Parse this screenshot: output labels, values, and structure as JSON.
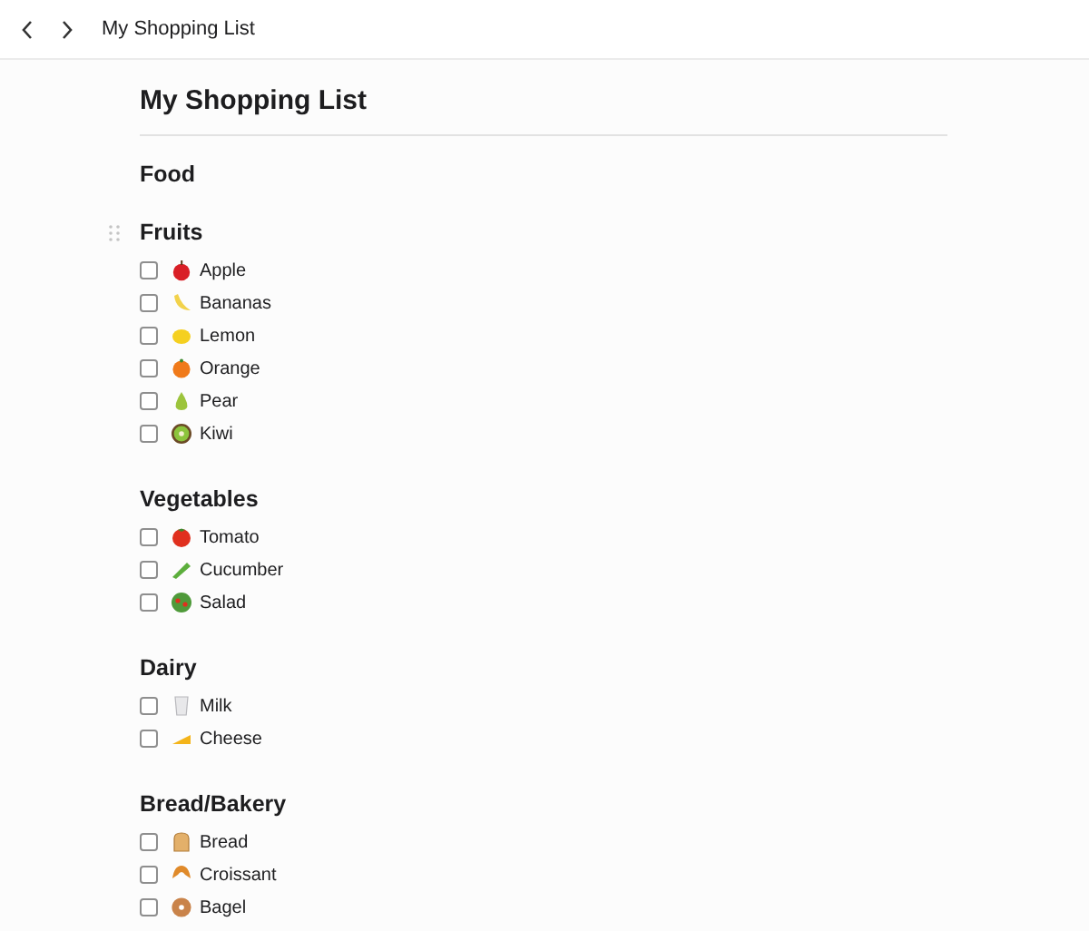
{
  "window": {
    "title": "My Shopping List"
  },
  "page": {
    "title": "My Shopping List",
    "subtitle": "Food"
  },
  "sections": [
    {
      "heading": "Fruits",
      "drag_handle": true,
      "items": [
        {
          "label": "Apple",
          "kind": "apple",
          "checked": false
        },
        {
          "label": "Bananas",
          "kind": "banana",
          "checked": false
        },
        {
          "label": "Lemon",
          "kind": "lemon",
          "checked": false
        },
        {
          "label": "Orange",
          "kind": "orange",
          "checked": false
        },
        {
          "label": "Pear",
          "kind": "pear",
          "checked": false
        },
        {
          "label": "Kiwi",
          "kind": "kiwi",
          "checked": false
        }
      ]
    },
    {
      "heading": "Vegetables",
      "drag_handle": false,
      "items": [
        {
          "label": "Tomato",
          "kind": "tomato",
          "checked": false
        },
        {
          "label": "Cucumber",
          "kind": "cucumber",
          "checked": false
        },
        {
          "label": "Salad",
          "kind": "salad",
          "checked": false
        }
      ]
    },
    {
      "heading": "Dairy",
      "drag_handle": false,
      "items": [
        {
          "label": "Milk",
          "kind": "milk",
          "checked": false
        },
        {
          "label": "Cheese",
          "kind": "cheese",
          "checked": false
        }
      ]
    },
    {
      "heading": "Bread/Bakery",
      "drag_handle": false,
      "items": [
        {
          "label": "Bread",
          "kind": "bread",
          "checked": false
        },
        {
          "label": "Croissant",
          "kind": "croissant",
          "checked": false
        },
        {
          "label": "Bagel",
          "kind": "bagel",
          "checked": false
        }
      ]
    }
  ]
}
